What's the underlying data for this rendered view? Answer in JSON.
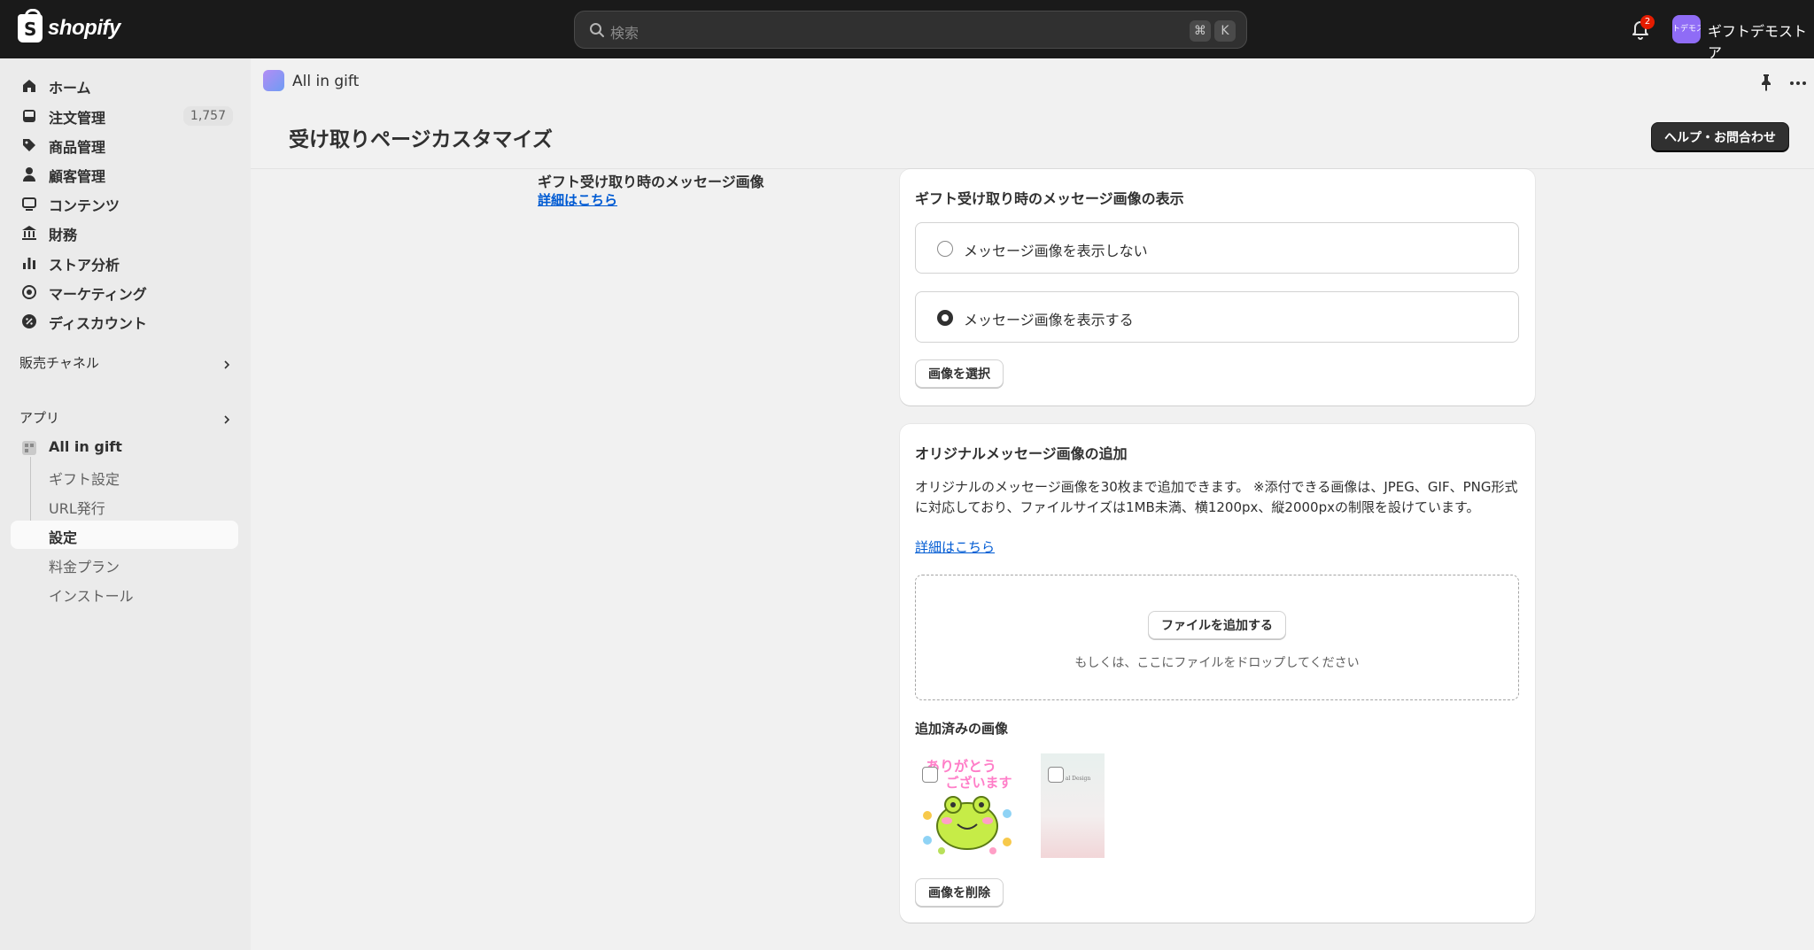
{
  "topbar": {
    "brand": "shopify",
    "search_placeholder": "検索",
    "shortcut_key1": "⌘",
    "shortcut_key2": "K",
    "notification_count": "2",
    "store_avatar_text": "トデモス",
    "store_name": "ギフトデモストア"
  },
  "sidebar": {
    "items": [
      {
        "label": "ホーム",
        "icon": "home-icon"
      },
      {
        "label": "注文管理",
        "icon": "inbox-icon",
        "count": "1,757"
      },
      {
        "label": "商品管理",
        "icon": "tag-icon"
      },
      {
        "label": "顧客管理",
        "icon": "person-icon"
      },
      {
        "label": "コンテンツ",
        "icon": "content-icon"
      },
      {
        "label": "財務",
        "icon": "bank-icon"
      },
      {
        "label": "ストア分析",
        "icon": "bar-chart-icon"
      },
      {
        "label": "マーケティング",
        "icon": "target-icon"
      },
      {
        "label": "ディスカウント",
        "icon": "discount-icon"
      }
    ],
    "sales_channels": "販売チャネル",
    "apps": "アプリ",
    "app_name": "All in gift",
    "app_sub": [
      "ギフト設定",
      "URL発行",
      "設定",
      "料金プラン",
      "インストール"
    ]
  },
  "appbar": {
    "title": "All in gift"
  },
  "page": {
    "title": "受け取りページカスタマイズ",
    "help_button": "ヘルプ・お問合わせ",
    "section_title": "ギフト受け取り時のメッセージ画像",
    "section_link": "詳細はこちら"
  },
  "card_display": {
    "title": "ギフト受け取り時のメッセージ画像の表示",
    "option_hide": "メッセージ画像を表示しない",
    "option_show": "メッセージ画像を表示する",
    "selected": "show",
    "select_button": "画像を選択"
  },
  "card_upload": {
    "title": "オリジナルメッセージ画像の追加",
    "description": "オリジナルのメッセージ画像を30枚まで追加できます。 ※添付できる画像は、JPEG、GIF、PNG形式に対応しており、ファイルサイズは1MB未満、横1200px、縦2000pxの制限を設けています。",
    "link": "詳細はこちら",
    "add_file_button": "ファイルを追加する",
    "drop_hint": "もしくは、ここにファイルをドロップしてください",
    "added_title": "追加済みの画像",
    "thumb1_text1": "ありがとう",
    "thumb1_text2": "ございます",
    "thumb2_text": "al Design",
    "delete_button": "画像を削除"
  },
  "colors": {
    "topbar": "#1a1a1a",
    "link": "#005bd3",
    "badge": "#e51c00",
    "avatar": "#8f6cf6"
  }
}
